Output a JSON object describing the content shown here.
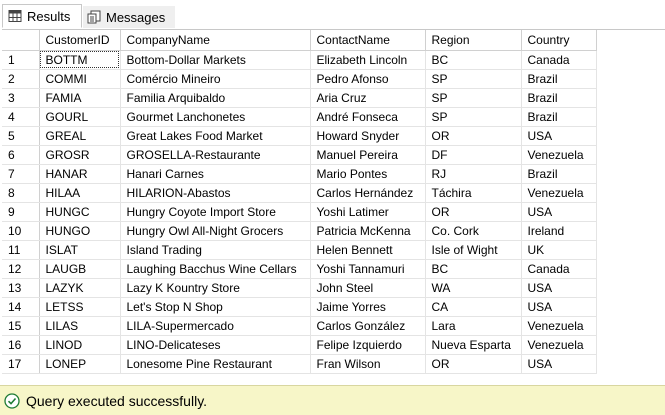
{
  "tabs": {
    "results_label": "Results",
    "messages_label": "Messages"
  },
  "grid": {
    "columns": [
      "CustomerID",
      "CompanyName",
      "ContactName",
      "Region",
      "Country"
    ],
    "rows": [
      {
        "num": "1",
        "cells": [
          "BOTTM",
          "Bottom-Dollar Markets",
          "Elizabeth Lincoln",
          "BC",
          "Canada"
        ]
      },
      {
        "num": "2",
        "cells": [
          "COMMI",
          "Comércio Mineiro",
          "Pedro Afonso",
          "SP",
          "Brazil"
        ]
      },
      {
        "num": "3",
        "cells": [
          "FAMIA",
          "Familia Arquibaldo",
          "Aria Cruz",
          "SP",
          "Brazil"
        ]
      },
      {
        "num": "4",
        "cells": [
          "GOURL",
          "Gourmet Lanchonetes",
          "André Fonseca",
          "SP",
          "Brazil"
        ]
      },
      {
        "num": "5",
        "cells": [
          "GREAL",
          "Great Lakes Food Market",
          "Howard Snyder",
          "OR",
          "USA"
        ]
      },
      {
        "num": "6",
        "cells": [
          "GROSR",
          "GROSELLA-Restaurante",
          "Manuel Pereira",
          "DF",
          "Venezuela"
        ]
      },
      {
        "num": "7",
        "cells": [
          "HANAR",
          "Hanari Carnes",
          "Mario Pontes",
          "RJ",
          "Brazil"
        ]
      },
      {
        "num": "8",
        "cells": [
          "HILAA",
          "HILARION-Abastos",
          "Carlos Hernández",
          "Táchira",
          "Venezuela"
        ]
      },
      {
        "num": "9",
        "cells": [
          "HUNGC",
          "Hungry Coyote Import Store",
          "Yoshi Latimer",
          "OR",
          "USA"
        ]
      },
      {
        "num": "10",
        "cells": [
          "HUNGO",
          "Hungry Owl All-Night Grocers",
          "Patricia McKenna",
          "Co. Cork",
          "Ireland"
        ]
      },
      {
        "num": "11",
        "cells": [
          "ISLAT",
          "Island Trading",
          "Helen Bennett",
          "Isle of Wight",
          "UK"
        ]
      },
      {
        "num": "12",
        "cells": [
          "LAUGB",
          "Laughing Bacchus Wine Cellars",
          "Yoshi Tannamuri",
          "BC",
          "Canada"
        ]
      },
      {
        "num": "13",
        "cells": [
          "LAZYK",
          "Lazy K Kountry Store",
          "John Steel",
          "WA",
          "USA"
        ]
      },
      {
        "num": "14",
        "cells": [
          "LETSS",
          "Let's Stop N Shop",
          "Jaime Yorres",
          "CA",
          "USA"
        ]
      },
      {
        "num": "15",
        "cells": [
          "LILAS",
          "LILA-Supermercado",
          "Carlos González",
          "Lara",
          "Venezuela"
        ]
      },
      {
        "num": "16",
        "cells": [
          "LINOD",
          "LINO-Delicateses",
          "Felipe Izquierdo",
          "Nueva Esparta",
          "Venezuela"
        ]
      },
      {
        "num": "17",
        "cells": [
          "LONEP",
          "Lonesome Pine Restaurant",
          "Fran Wilson",
          "OR",
          "USA"
        ]
      }
    ]
  },
  "status": {
    "message": "Query executed successfully.",
    "color": "#f7f6c8",
    "icon": "check-circle-icon"
  }
}
